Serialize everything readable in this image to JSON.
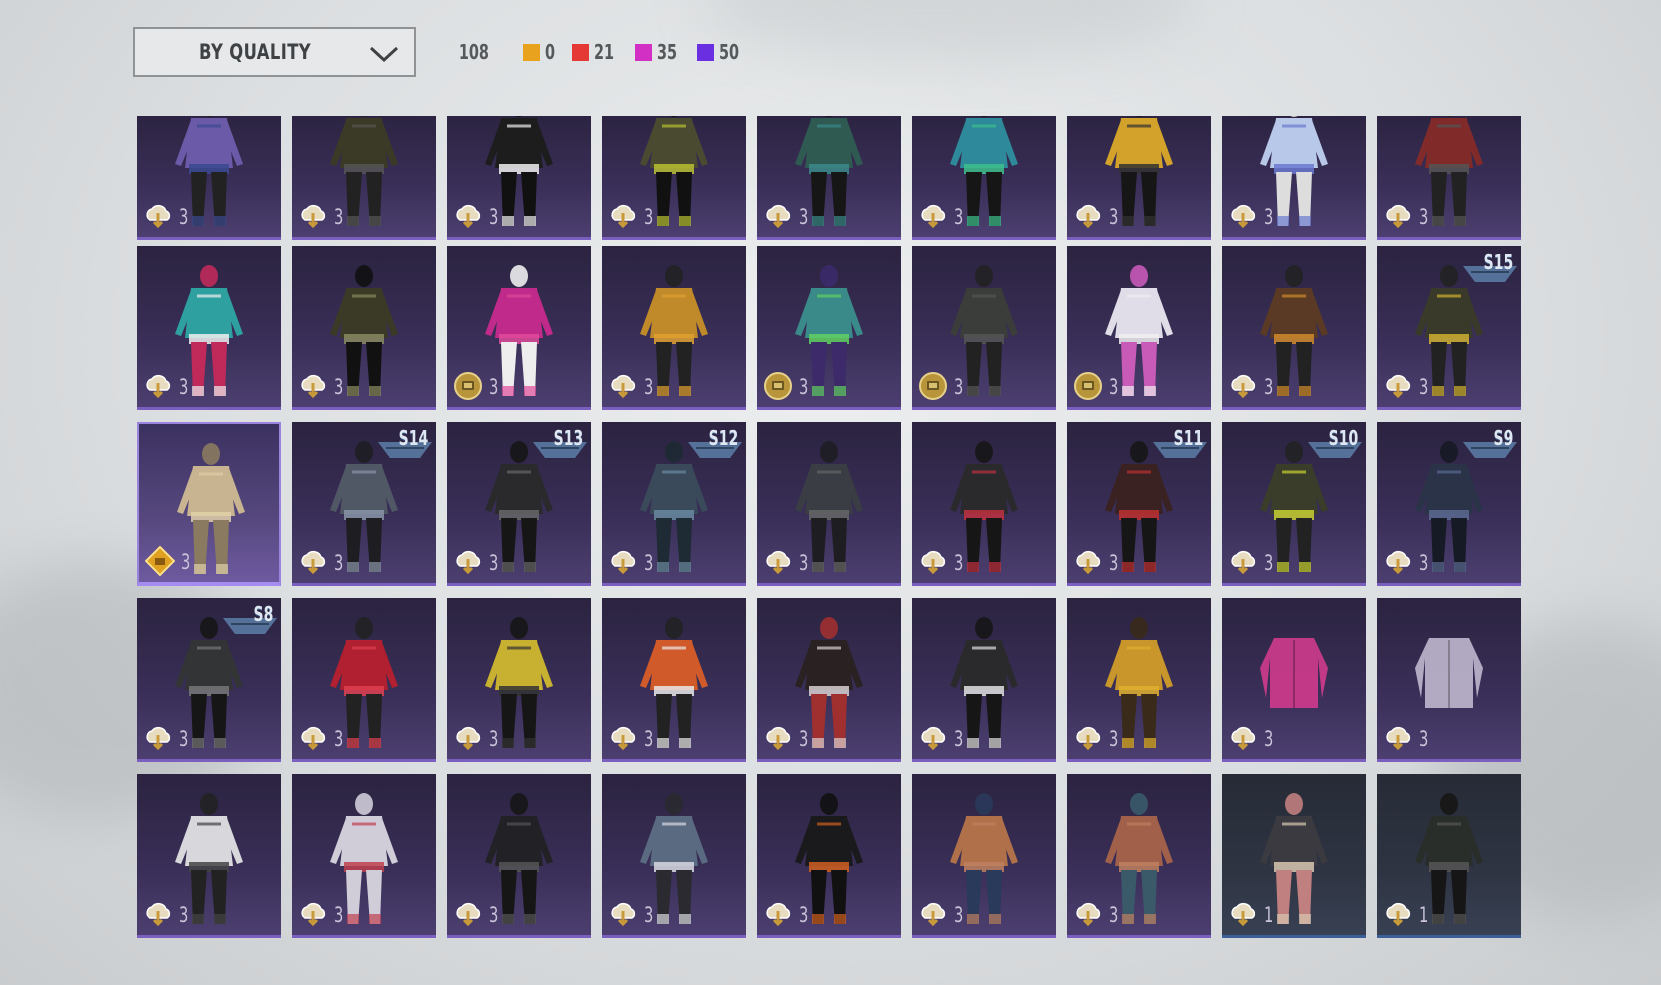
{
  "sort": {
    "label": "BY QUALITY"
  },
  "total_count": "108",
  "quality_stats": [
    {
      "color": "#e8a21d",
      "count": "0"
    },
    {
      "color": "#e53935",
      "count": "21"
    },
    {
      "color": "#d22fc4",
      "count": "35"
    },
    {
      "color": "#6a2fe0",
      "count": "50"
    }
  ],
  "items": [
    {
      "badge": "cloud-icon",
      "count": "3",
      "palette": [
        "#6a5aa8",
        "#222",
        "#3a4a90"
      ]
    },
    {
      "badge": "cloud-icon",
      "count": "3",
      "palette": [
        "#3b3a26",
        "#222",
        "#555"
      ]
    },
    {
      "badge": "cloud-icon",
      "count": "3",
      "palette": [
        "#1d1d1d",
        "#111",
        "#eee"
      ]
    },
    {
      "badge": "cloud-icon",
      "count": "3",
      "palette": [
        "#4a4a30",
        "#111",
        "#b8c030"
      ]
    },
    {
      "badge": "cloud-icon",
      "count": "3",
      "palette": [
        "#2f5a52",
        "#161616",
        "#3a8a8a"
      ]
    },
    {
      "badge": "cloud-icon",
      "count": "3",
      "palette": [
        "#2e8a9a",
        "#161616",
        "#3cc08a"
      ]
    },
    {
      "badge": "cloud-icon",
      "count": "3",
      "palette": [
        "#d2a22a",
        "#161616",
        "#333"
      ]
    },
    {
      "badge": "cloud-icon",
      "count": "3",
      "palette": [
        "#b8c8e8",
        "#dddddd",
        "#6a7ad0"
      ]
    },
    {
      "badge": "cloud-icon",
      "count": "3",
      "palette": [
        "#802a2a",
        "#222",
        "#555"
      ]
    },
    {
      "badge": "cloud-icon",
      "count": "3",
      "palette": [
        "#2ea0a0",
        "#c02a5a",
        "#eee"
      ]
    },
    {
      "badge": "cloud-icon",
      "count": "3",
      "palette": [
        "#3b3a26",
        "#111",
        "#8a8a60"
      ]
    },
    {
      "badge": "coin-icon",
      "count": "3",
      "palette": [
        "#c02a8a",
        "#eee",
        "#e04a9a"
      ]
    },
    {
      "badge": "cloud-icon",
      "count": "3",
      "palette": [
        "#c08a2a",
        "#222",
        "#e0a030"
      ]
    },
    {
      "badge": "coin-icon",
      "count": "3",
      "palette": [
        "#3a8a8a",
        "#3c2a6a",
        "#60d060"
      ]
    },
    {
      "badge": "coin-icon",
      "count": "3",
      "palette": [
        "#3a3d3a",
        "#222",
        "#555"
      ]
    },
    {
      "badge": "coin-icon",
      "count": "3",
      "palette": [
        "#e0dce8",
        "#c85ab8",
        "#eee"
      ]
    },
    {
      "badge": "cloud-icon",
      "count": "3",
      "palette": [
        "#5a3a24",
        "#222",
        "#d08a2a"
      ]
    },
    {
      "badge": "cloud-icon",
      "count": "3",
      "palette": [
        "#3a3a2a",
        "#222",
        "#d0b030"
      ],
      "season": "S15"
    },
    {
      "badge": "diamond-icon",
      "count": "3",
      "palette": [
        "#c8b490",
        "#8a7a60",
        "#e0d0a8"
      ],
      "highlight": true
    },
    {
      "badge": "cloud-icon",
      "count": "3",
      "palette": [
        "#505866",
        "#1e1e22",
        "#8a94a8"
      ],
      "season": "S14"
    },
    {
      "badge": "cloud-icon",
      "count": "3",
      "palette": [
        "#2a2a2c",
        "#161616",
        "#666"
      ],
      "season": "S13"
    },
    {
      "badge": "cloud-icon",
      "count": "3",
      "palette": [
        "#3a4a5a",
        "#1e2a34",
        "#6a8aa0"
      ],
      "season": "S12"
    },
    {
      "badge": "cloud-icon",
      "count": "3",
      "palette": [
        "#3a3d44",
        "#1e1e22",
        "#666"
      ]
    },
    {
      "badge": "cloud-icon",
      "count": "3",
      "palette": [
        "#2a2a2c",
        "#161616",
        "#c03040"
      ]
    },
    {
      "badge": "cloud-icon",
      "count": "3",
      "palette": [
        "#3a2222",
        "#161616",
        "#c03030"
      ],
      "season": "S11"
    },
    {
      "badge": "cloud-icon",
      "count": "3",
      "palette": [
        "#3a3d2a",
        "#222",
        "#c8d030"
      ],
      "season": "S10"
    },
    {
      "badge": "cloud-icon",
      "count": "3",
      "palette": [
        "#2a3348",
        "#161a24",
        "#5a6a90"
      ],
      "season": "S9"
    },
    {
      "badge": "cloud-icon",
      "count": "3",
      "palette": [
        "#333436",
        "#161616",
        "#777"
      ],
      "season": "S8"
    },
    {
      "badge": "cloud-icon",
      "count": "3",
      "palette": [
        "#b02030",
        "#222",
        "#e04050"
      ]
    },
    {
      "badge": "cloud-icon",
      "count": "3",
      "palette": [
        "#c8b030",
        "#161616",
        "#333"
      ]
    },
    {
      "badge": "cloud-icon",
      "count": "3",
      "palette": [
        "#d05a2a",
        "#222",
        "#e8e8e8"
      ]
    },
    {
      "badge": "cloud-icon",
      "count": "3",
      "palette": [
        "#2a2222",
        "#a03030",
        "#d8d0d0"
      ]
    },
    {
      "badge": "cloud-icon",
      "count": "3",
      "palette": [
        "#2a2a2c",
        "#161616",
        "#e0e0e0"
      ]
    },
    {
      "badge": "cloud-icon",
      "count": "3",
      "palette": [
        "#c8962a",
        "#3a2a1a",
        "#e0b030"
      ]
    },
    {
      "badge": "cloud-icon",
      "count": "3",
      "palette": [
        "#c83a8a",
        "#c83a8a",
        "#c83a8a"
      ],
      "coat": true
    },
    {
      "badge": "cloud-icon",
      "count": "3",
      "palette": [
        "#b8b0c8",
        "#b8b0c8",
        "#b8b0c8"
      ],
      "coat": true
    },
    {
      "badge": "cloud-icon",
      "count": "3",
      "palette": [
        "#d8d8dc",
        "#222",
        "#444"
      ]
    },
    {
      "badge": "cloud-icon",
      "count": "3",
      "palette": [
        "#d0ccd8",
        "#d0ccd8",
        "#c04050"
      ]
    },
    {
      "badge": "cloud-icon",
      "count": "3",
      "palette": [
        "#222226",
        "#161616",
        "#555"
      ]
    },
    {
      "badge": "cloud-icon",
      "count": "3",
      "palette": [
        "#5a6a80",
        "#2a2a30",
        "#d8d8e0"
      ]
    },
    {
      "badge": "cloud-icon",
      "count": "3",
      "palette": [
        "#1a1a1c",
        "#111",
        "#d06020"
      ]
    },
    {
      "badge": "cloud-icon",
      "count": "3",
      "palette": [
        "#b0704a",
        "#2a3a5a",
        "#c08060"
      ]
    },
    {
      "badge": "cloud-icon",
      "count": "3",
      "palette": [
        "#a0604a",
        "#3a5a6a",
        "#c08060"
      ]
    },
    {
      "badge": "cloud-icon",
      "count": "1",
      "palette": [
        "#3a3a40",
        "#c08080",
        "#d8c8b0"
      ],
      "grey": true
    },
    {
      "badge": "cloud-icon",
      "count": "1",
      "palette": [
        "#2a2e2a",
        "#161616",
        "#555"
      ],
      "grey": true
    }
  ]
}
